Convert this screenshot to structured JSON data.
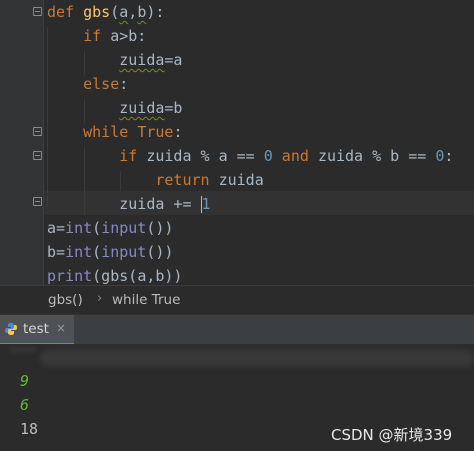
{
  "editor": {
    "lines": [
      {
        "indent": "",
        "parts": [
          [
            "kw",
            "def "
          ],
          [
            "fn",
            "gbs"
          ],
          [
            "",
            "("
          ],
          [
            "squig",
            "a"
          ],
          [
            "",
            ","
          ],
          [
            "squig",
            "b"
          ],
          [
            "",
            "):"
          ]
        ]
      },
      {
        "indent": "    ",
        "parts": [
          [
            "kw",
            "if "
          ],
          [
            "",
            "a>b:"
          ]
        ]
      },
      {
        "indent": "        ",
        "parts": [
          [
            "squig",
            "zuida"
          ],
          [
            "",
            "=a"
          ]
        ]
      },
      {
        "indent": "    ",
        "parts": [
          [
            "kw",
            "else"
          ],
          [
            "",
            ":"
          ]
        ]
      },
      {
        "indent": "        ",
        "parts": [
          [
            "squig",
            "zuida"
          ],
          [
            "",
            "=b"
          ]
        ]
      },
      {
        "indent": "    ",
        "parts": [
          [
            "kw",
            "while "
          ],
          [
            "kw",
            "True"
          ],
          [
            "",
            ":"
          ]
        ]
      },
      {
        "indent": "        ",
        "parts": [
          [
            "kw",
            "if "
          ],
          [
            "",
            "zuida % a == "
          ],
          [
            "num",
            "0"
          ],
          [
            "kw",
            " and "
          ],
          [
            "",
            "zuida % b == "
          ],
          [
            "num",
            "0"
          ],
          [
            "",
            ":"
          ]
        ]
      },
      {
        "indent": "            ",
        "parts": [
          [
            "kw",
            "return "
          ],
          [
            "",
            "zuida"
          ]
        ]
      },
      {
        "indent": "        ",
        "parts": [
          [
            "",
            "zuida += "
          ],
          [
            "caret",
            ""
          ],
          [
            "num",
            "1"
          ]
        ]
      },
      {
        "indent": "",
        "parts": [
          [
            "",
            "a="
          ],
          [
            "bi",
            "int"
          ],
          [
            "",
            "("
          ],
          [
            "bi",
            "input"
          ],
          [
            "",
            "())"
          ]
        ]
      },
      {
        "indent": "",
        "parts": [
          [
            "",
            "b="
          ],
          [
            "bi",
            "int"
          ],
          [
            "",
            "("
          ],
          [
            "bi",
            "input"
          ],
          [
            "",
            "())"
          ]
        ]
      },
      {
        "indent": "",
        "parts": [
          [
            "bi",
            "print"
          ],
          [
            "",
            "(gbs("
          ],
          [
            "",
            "a"
          ],
          [
            "",
            ","
          ],
          [
            "",
            "b"
          ],
          [
            "",
            "))"
          ]
        ]
      }
    ]
  },
  "breadcrumb": {
    "items": [
      "gbs()",
      "while True"
    ],
    "separator": "›"
  },
  "run_panel": {
    "tab_label": "test",
    "tab_close": "×",
    "tab_icon": "python-icon"
  },
  "console": {
    "lines": [
      {
        "kind": "in",
        "text": "9"
      },
      {
        "kind": "in",
        "text": "6"
      },
      {
        "kind": "res",
        "text": "18"
      }
    ]
  },
  "watermark": "CSDN @新境339",
  "colors": {
    "keyword": "#cc7832",
    "function": "#ffc66d",
    "builtin": "#8888c6",
    "number": "#6897bb",
    "input_text": "#62b543",
    "background": "#2b2b2b"
  }
}
